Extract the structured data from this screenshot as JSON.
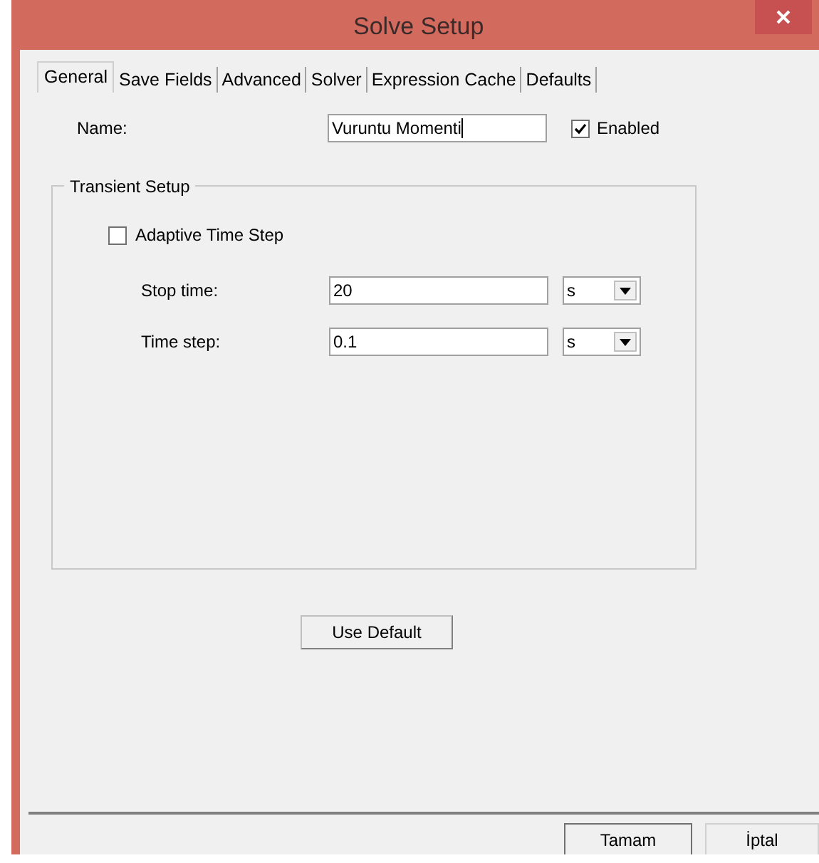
{
  "window": {
    "title": "Solve Setup"
  },
  "tabs": [
    {
      "label": "General",
      "selected": true
    },
    {
      "label": "Save Fields",
      "selected": false
    },
    {
      "label": "Advanced",
      "selected": false
    },
    {
      "label": "Solver",
      "selected": false
    },
    {
      "label": "Expression Cache",
      "selected": false
    },
    {
      "label": "Defaults",
      "selected": false
    }
  ],
  "name": {
    "label": "Name:",
    "value": "Vuruntu Momenti"
  },
  "enabled": {
    "label": "Enabled",
    "checked": true
  },
  "transient_setup": {
    "title": "Transient Setup",
    "adaptive_time_step": {
      "label": "Adaptive Time Step",
      "checked": false
    },
    "fields": [
      {
        "label": "Stop time:",
        "value": "20",
        "unit": "s"
      },
      {
        "label": "Time step:",
        "value": "0.1",
        "unit": "s"
      }
    ]
  },
  "use_default_button": "Use Default",
  "buttons": [
    {
      "label": "Tamam",
      "default": true
    },
    {
      "label": "İptal",
      "default": false
    }
  ]
}
